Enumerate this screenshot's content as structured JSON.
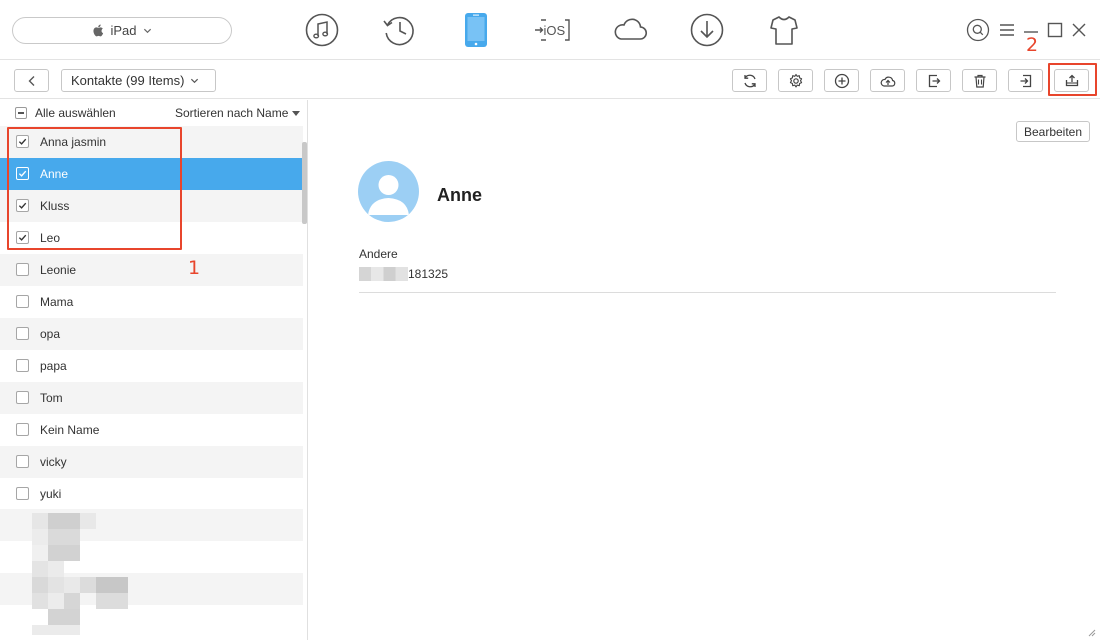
{
  "device": {
    "name": "iPad"
  },
  "nav": {
    "icons": [
      "music-icon",
      "history-icon",
      "device-icon",
      "ios-transfer-icon",
      "cloud-icon",
      "download-icon",
      "tshirt-icon"
    ],
    "ios_label": "iOS",
    "active_color": "#47a9ec"
  },
  "annotations": {
    "marker_1": "1",
    "marker_2": "2",
    "highlight_color": "#e8452c"
  },
  "toolbar": {
    "category_label": "Kontakte (99 Items)",
    "buttons": [
      "refresh-icon",
      "settings-icon",
      "add-icon",
      "upload-cloud-icon",
      "export-icon",
      "delete-icon",
      "import-icon",
      "export-to-pc-icon"
    ]
  },
  "list": {
    "select_all_label": "Alle auswählen",
    "sort_label": "Sortieren nach Name",
    "items": [
      {
        "name": "Anna jasmin",
        "checked": true
      },
      {
        "name": "Anne",
        "checked": true,
        "selected": true
      },
      {
        "name": "Kluss",
        "checked": true
      },
      {
        "name": "Leo",
        "checked": true
      },
      {
        "name": "Leonie",
        "checked": false
      },
      {
        "name": "Mama",
        "checked": false
      },
      {
        "name": "opa",
        "checked": false
      },
      {
        "name": "papa",
        "checked": false
      },
      {
        "name": "Tom",
        "checked": false
      },
      {
        "name": "Kein Name",
        "checked": false
      },
      {
        "name": "vicky",
        "checked": false
      },
      {
        "name": "yuki",
        "checked": false
      }
    ],
    "selected_color": "#47a9ec"
  },
  "detail": {
    "edit_label": "Bearbeiten",
    "contact_name": "Anne",
    "field_label": "Andere",
    "field_value_visible": "181325"
  }
}
